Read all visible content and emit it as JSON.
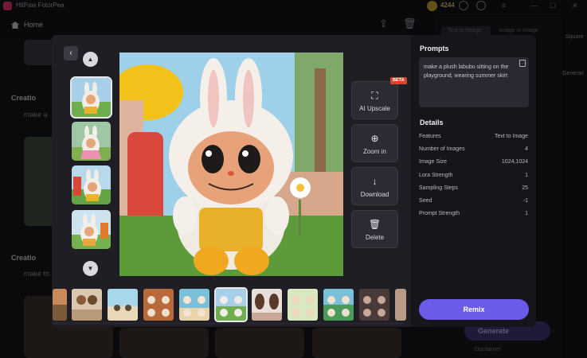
{
  "app": {
    "title": "HitPaw FotorPea",
    "credits": "4244"
  },
  "nav": {
    "home_label": "Home"
  },
  "background": {
    "sections": [
      {
        "heading": "Creatio",
        "sub": "make a"
      },
      {
        "heading": "Creatio",
        "sub": "make th"
      }
    ],
    "right_tabs": [
      "Text to Image",
      "Image to Image"
    ],
    "side_items": [
      "Square",
      "Generati"
    ],
    "generate_label": "Generate",
    "disclaimer": "Disclaimer"
  },
  "viewer": {
    "tools": [
      {
        "label": "AI Upscale",
        "icon": "upscale-icon",
        "badge": "BETA"
      },
      {
        "label": "Zoom in",
        "icon": "zoom-in-icon"
      },
      {
        "label": "Download",
        "icon": "download-icon"
      },
      {
        "label": "Delete",
        "icon": "trash-icon"
      }
    ]
  },
  "panel": {
    "prompts_title": "Prompts",
    "prompt": "make a plush labubu sitting on the playground, wearing summer skirt",
    "details_title": "Details",
    "details": [
      {
        "key": "Features",
        "value": "Text to Image"
      },
      {
        "key": "Number of Images",
        "value": "4"
      },
      {
        "key": "Image Size",
        "value": "1024,1024"
      },
      {
        "key": "Lora Strength",
        "value": "1"
      },
      {
        "key": "Sampling Steps",
        "value": "25"
      },
      {
        "key": "Seed",
        "value": "-1"
      },
      {
        "key": "Prompt Strength",
        "value": "1"
      }
    ],
    "remix_label": "Remix"
  },
  "colors": {
    "accent": "#6a5ce8",
    "beta_badge": "#d8432a"
  }
}
